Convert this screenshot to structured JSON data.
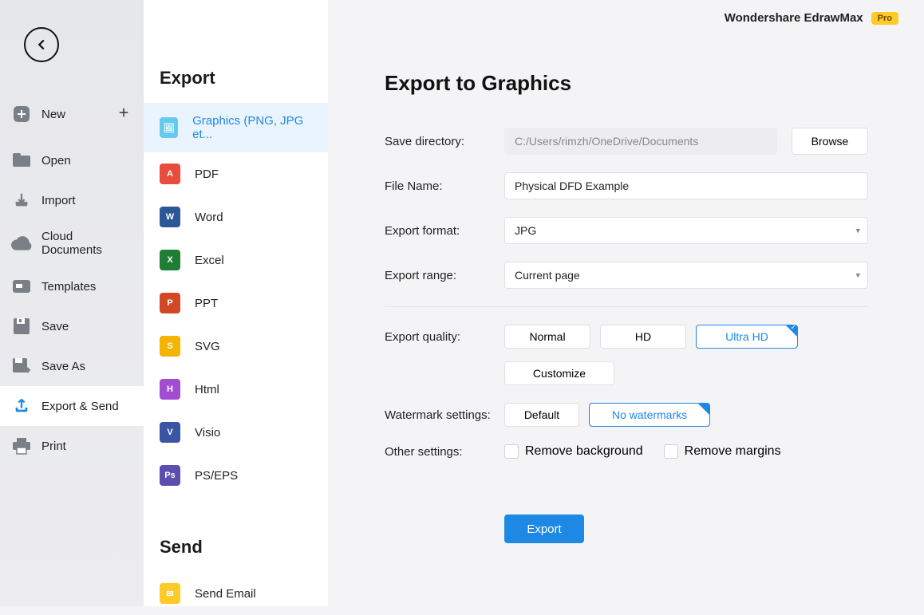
{
  "header": {
    "brand": "Wondershare EdrawMax",
    "pro": "Pro"
  },
  "nav": {
    "new": "New",
    "open": "Open",
    "import": "Import",
    "cloud": "Cloud Documents",
    "templates": "Templates",
    "save": "Save",
    "saveas": "Save As",
    "exportsend": "Export & Send",
    "print": "Print"
  },
  "export_section": "Export",
  "export_items": {
    "graphics": "Graphics (PNG, JPG et...",
    "pdf": "PDF",
    "word": "Word",
    "excel": "Excel",
    "ppt": "PPT",
    "svg": "SVG",
    "html": "Html",
    "visio": "Visio",
    "pseps": "PS/EPS"
  },
  "send_section": "Send",
  "send_items": {
    "email": "Send Email"
  },
  "main": {
    "title": "Export to Graphics",
    "labels": {
      "dir": "Save directory:",
      "filename": "File Name:",
      "format": "Export format:",
      "range": "Export range:",
      "quality": "Export quality:",
      "watermark": "Watermark settings:",
      "other": "Other settings:"
    },
    "dir_value": "C:/Users/rimzh/OneDrive/Documents",
    "browse": "Browse",
    "filename": "Physical DFD Example",
    "format": "JPG",
    "range": "Current page",
    "quality": {
      "normal": "Normal",
      "hd": "HD",
      "ultra": "Ultra HD",
      "customize": "Customize"
    },
    "watermark": {
      "default": "Default",
      "none": "No watermarks"
    },
    "other": {
      "rmbg": "Remove background",
      "rmmargin": "Remove margins"
    },
    "export_btn": "Export"
  }
}
